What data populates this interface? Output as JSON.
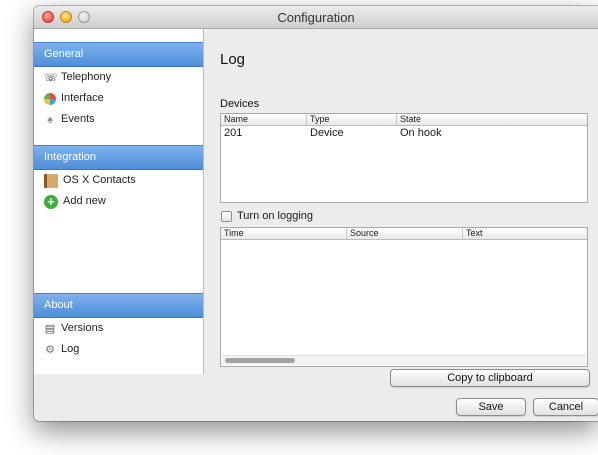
{
  "window": {
    "title": "Configuration"
  },
  "sidebar": {
    "groups": [
      {
        "header": "General",
        "items": [
          {
            "label": "Telephony",
            "icon": "phone-icon"
          },
          {
            "label": "Interface",
            "icon": "color-wheel-icon"
          },
          {
            "label": "Events",
            "icon": "bell-icon"
          }
        ]
      },
      {
        "header": "Integration",
        "items": [
          {
            "label": "OS X Contacts",
            "icon": "address-book-icon"
          },
          {
            "label": "Add new",
            "icon": "add-icon"
          }
        ]
      },
      {
        "header": "About",
        "items": [
          {
            "label": "Versions",
            "icon": "document-icon"
          },
          {
            "label": "Log",
            "icon": "log-icon"
          }
        ]
      }
    ]
  },
  "main": {
    "title": "Log",
    "devices_label": "Devices",
    "devices_table": {
      "columns": [
        "Name",
        "Type",
        "State"
      ],
      "rows": [
        [
          "201",
          "Device",
          "On hook"
        ]
      ]
    },
    "logging_checkbox": {
      "label": "Turn on logging",
      "checked": false
    },
    "log_table": {
      "columns": [
        "Time",
        "Source",
        "Text"
      ],
      "rows": []
    },
    "copy_button": "Copy to clipboard"
  },
  "footer": {
    "save_button": "Save",
    "cancel_button": "Cancel"
  },
  "colors": {
    "sidebar_header": "#5a97e0",
    "window_bg": "#ececec"
  }
}
